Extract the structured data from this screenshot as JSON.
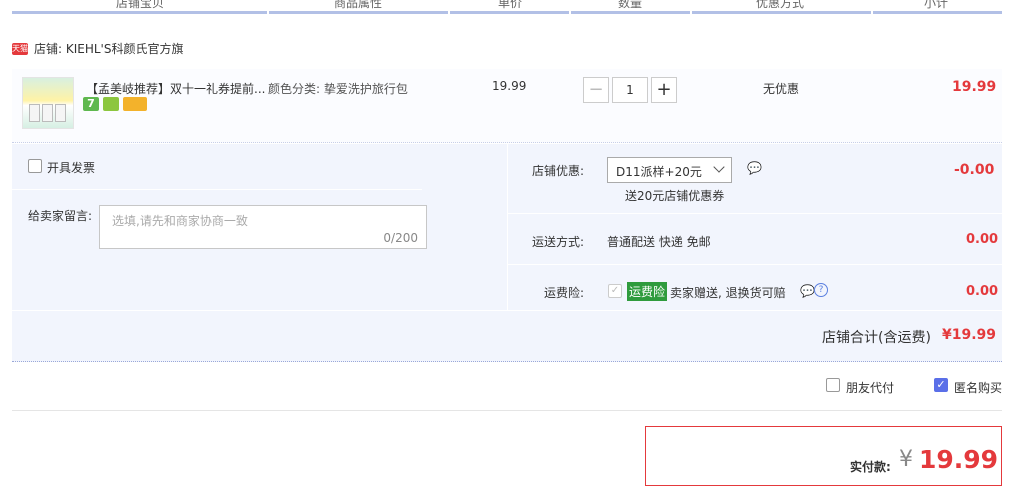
{
  "header": {
    "columns": [
      "店铺宝贝",
      "商品属性",
      "单价",
      "数量",
      "优惠方式",
      "小计"
    ]
  },
  "shop": {
    "badge": "天猫",
    "name": "店铺: KIEHL'S科颜氏官方旗"
  },
  "item": {
    "title": "【孟美岐推荐】双十一礼券提前...",
    "attribute": "颜色分类: 挚爱洗护旅行包",
    "unit_price": "19.99",
    "quantity": "1",
    "minus_label": "−",
    "plus_label": "+",
    "discount": "无优惠",
    "subtotal": "19.99"
  },
  "options": {
    "invoice_label": "开具发票",
    "message_label": "给卖家留言:",
    "message_placeholder": "选填,请先和商家协商一致",
    "message_counter": "0/200"
  },
  "shop_discount": {
    "label": "店铺优惠:",
    "selected": "D11派样+20元",
    "note": "送20元店铺优惠券",
    "amount": "-0.00"
  },
  "shipping": {
    "label": "运送方式:",
    "value": "普通配送 快递 免邮",
    "amount": "0.00"
  },
  "insurance": {
    "label": "运费险:",
    "badge": "运费险",
    "desc": "卖家赠送, 退换货可赔",
    "amount": "0.00"
  },
  "shop_total": {
    "label": "店铺合计(含运费)",
    "amount": "¥19.99"
  },
  "extras": {
    "friend_pay_label": "朋友代付",
    "anonymous_label": "匿名购买",
    "anonymous_checked": true
  },
  "payment": {
    "label": "实付款:",
    "currency": "¥",
    "amount": "19.99"
  },
  "colors": {
    "accent_red": "#e4393c",
    "header_bar": "#b2c0e6",
    "panel_bg": "#f2f5fd"
  }
}
